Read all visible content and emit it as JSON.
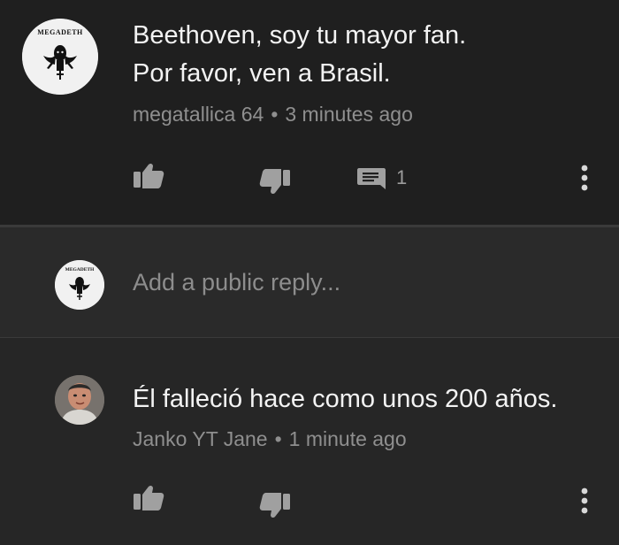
{
  "comment": {
    "lines": [
      "Beethoven, soy tu mayor fan.",
      "Por favor, ven a Brasil."
    ],
    "author": "megatallica 64",
    "separator": "•",
    "time": "3 minutes ago",
    "reply_count": "1",
    "avatar_logo_text": "MEGADETH",
    "actions": {
      "like_icon": "thumbs-up-icon",
      "dislike_icon": "thumbs-down-icon",
      "reply_icon": "comment-icon",
      "menu_icon": "more-vertical-icon"
    }
  },
  "reply_box": {
    "placeholder": "Add a public reply...",
    "avatar_logo_text": "MEGADETH"
  },
  "reply": {
    "text": "Él falleció hace como unos 200 años.",
    "author": "Janko YT Jane",
    "separator": "•",
    "time": "1 minute ago",
    "actions": {
      "like_icon": "thumbs-up-icon",
      "dislike_icon": "thumbs-down-icon",
      "menu_icon": "more-vertical-icon"
    }
  },
  "colors": {
    "background": "#242424",
    "text": "#f3f3f3",
    "secondary_text": "#8f8f8f",
    "icon": "#a0a0a0"
  }
}
